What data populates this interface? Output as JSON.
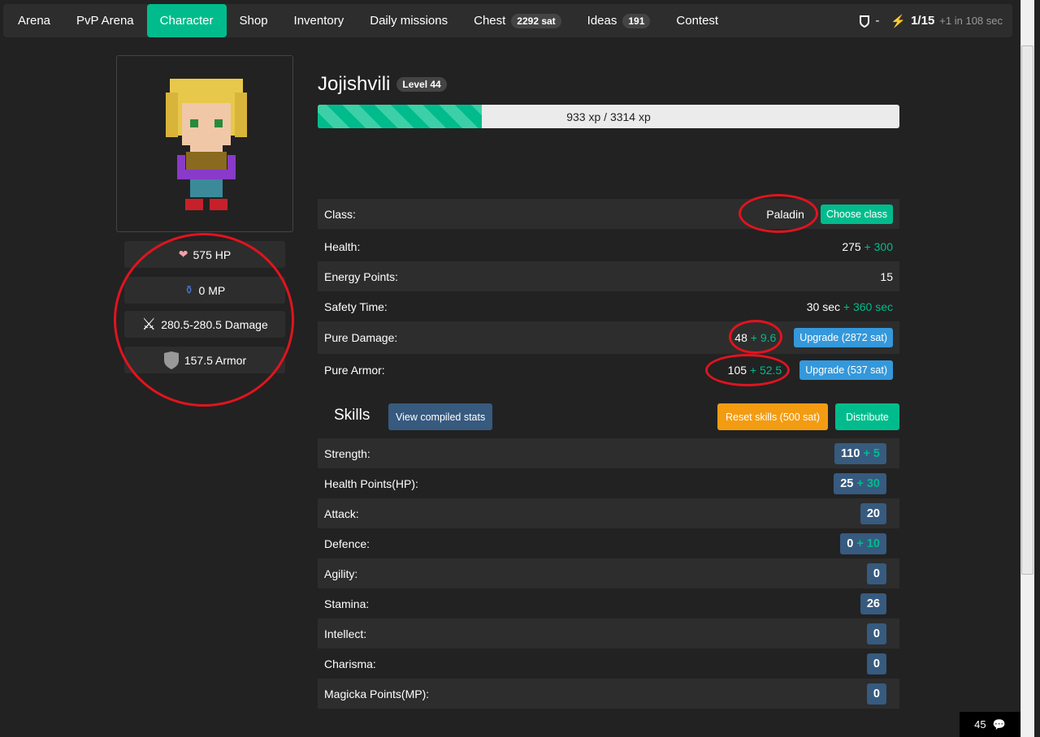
{
  "nav": {
    "items": [
      "Arena",
      "PvP Arena",
      "Character",
      "Shop",
      "Inventory",
      "Daily missions",
      "Chest",
      "Ideas",
      "Contest"
    ],
    "chest_badge": "2292 sat",
    "ideas_badge": "191",
    "shield_value": "-",
    "energy": "1/15",
    "energy_regen": "+1 in 108 sec"
  },
  "character": {
    "name": "Jojishvili",
    "level": "Level 44",
    "xp": "933 xp / 3314 xp",
    "xp_fraction": 0.2815,
    "stats": {
      "hp": "575 HP",
      "mp": "0 MP",
      "damage": "280.5-280.5 Damage",
      "armor": "157.5 Armor"
    }
  },
  "info": [
    {
      "label": "Class:",
      "value": "Paladin",
      "button": "Choose class"
    },
    {
      "label": "Health:",
      "value": "275",
      "bonus": "+ 300"
    },
    {
      "label": "Energy Points:",
      "value": "15"
    },
    {
      "label": "Safety Time:",
      "value": "30 sec",
      "bonus": "+ 360 sec"
    },
    {
      "label": "Pure Damage:",
      "value": "48",
      "bonus": "+ 9.6",
      "button": "Upgrade (2872 sat)"
    },
    {
      "label": "Pure Armor:",
      "value": "105",
      "bonus": "+ 52.5",
      "button": "Upgrade (537 sat)"
    }
  ],
  "skills": {
    "title": "Skills",
    "view_btn": "View compiled stats",
    "reset_btn": "Reset skills (500 sat)",
    "distribute_btn": "Distribute",
    "rows": [
      {
        "label": "Strength:",
        "value": "110",
        "bonus": "+ 5"
      },
      {
        "label": "Health Points(HP):",
        "value": "25",
        "bonus": "+ 30"
      },
      {
        "label": "Attack:",
        "value": "20"
      },
      {
        "label": "Defence:",
        "value": "0",
        "bonus": "+ 10"
      },
      {
        "label": "Agility:",
        "value": "0"
      },
      {
        "label": "Stamina:",
        "value": "26"
      },
      {
        "label": "Intellect:",
        "value": "0"
      },
      {
        "label": "Charisma:",
        "value": "0"
      },
      {
        "label": "Magicka Points(MP):",
        "value": "0"
      }
    ]
  },
  "chat": {
    "count": "45"
  },
  "colors": {
    "accent": "#00bc8c",
    "annotation": "#e0141e"
  }
}
